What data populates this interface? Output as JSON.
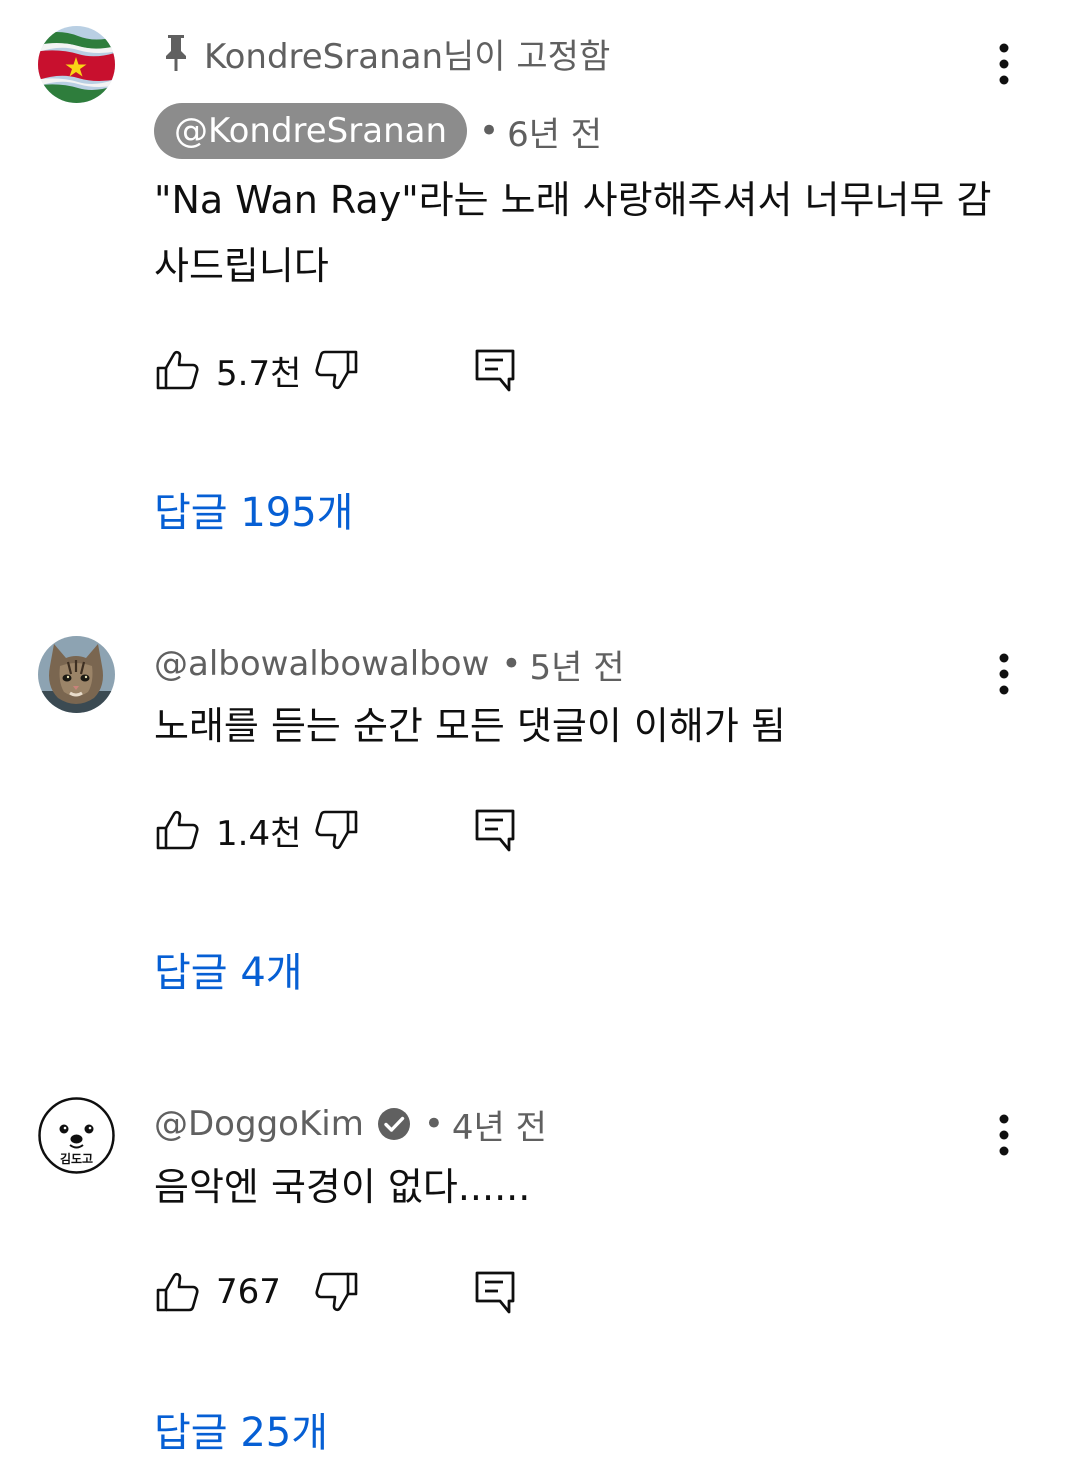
{
  "comments": [
    {
      "pinned_label": "KondreSranan님이 고정함",
      "author": "@KondreSranan",
      "time": "6년 전",
      "text": "\"Na Wan Ray\"라는 노래 사랑해주셔서 너무너무 감사드립니다",
      "likes": "5.7천",
      "replies": "답글 195개",
      "avatar_icon": "suriname-flag-avatar",
      "author_highlighted": true
    },
    {
      "author": "@albowalbowalbow",
      "time": "5년 전",
      "text": "노래를 듣는 순간 모든 댓글이 이해가 됨",
      "likes": "1.4천",
      "replies": "답글 4개",
      "avatar_icon": "cat-photo-avatar"
    },
    {
      "author": "@DoggoKim",
      "verified": true,
      "time": "4년 전",
      "text": "음악엔 국경이 없다......",
      "likes": "767",
      "replies": "답글 25개",
      "avatar_icon": "dog-face-avatar",
      "avatar_text": "김도고"
    }
  ],
  "separator": "•",
  "icons": {
    "pin": "pin-icon",
    "like": "thumbs-up-icon",
    "dislike": "thumbs-down-icon",
    "reply": "comment-reply-icon",
    "menu": "more-vert-icon",
    "verified": "verified-check-icon"
  },
  "colors": {
    "link": "#065fd4",
    "secondary_text": "#606060",
    "chip_bg": "#8c8c8c"
  }
}
